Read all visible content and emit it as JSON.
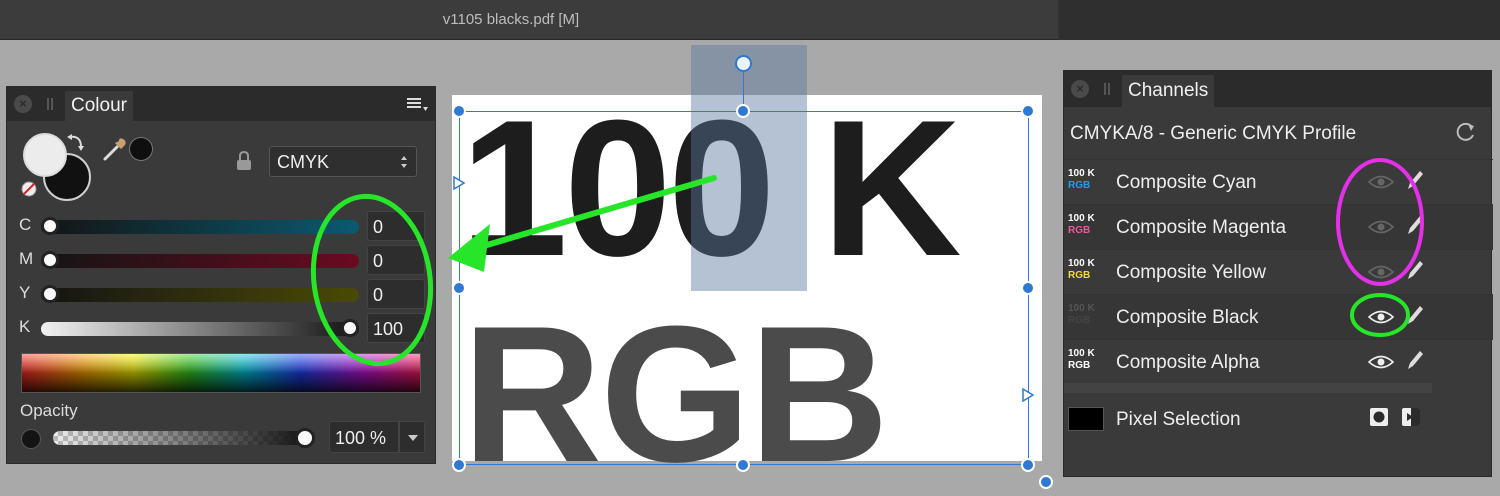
{
  "window": {
    "title": "v1105 blacks.pdf [M]"
  },
  "colour_panel": {
    "tab_label": "Colour",
    "model": "CMYK",
    "sliders": [
      {
        "label": "C",
        "value": "0",
        "fraction": 0.0,
        "color": "#0a5a70"
      },
      {
        "label": "M",
        "value": "0",
        "fraction": 0.0,
        "color": "#6a0a22"
      },
      {
        "label": "Y",
        "value": "0",
        "fraction": 0.0,
        "color": "#4a4a06"
      },
      {
        "label": "K",
        "value": "100",
        "fraction": 1.0,
        "color": "#ffffff"
      }
    ],
    "opacity_label": "Opacity",
    "opacity_value": "100 %",
    "opacity_fraction": 1.0
  },
  "canvas": {
    "line1": "100 K",
    "line2": "RGB"
  },
  "channels_panel": {
    "tab_label": "Channels",
    "profile": "CMYKA/8 - Generic CMYK Profile",
    "channels": [
      {
        "thumb_top": "100 K",
        "thumb_bottom": "RGB",
        "thumb_color": "#1aa3e8",
        "name": "Composite Cyan",
        "visible": false
      },
      {
        "thumb_top": "100 K",
        "thumb_bottom": "RGB",
        "thumb_color": "#e85a9c",
        "name": "Composite Magenta",
        "visible": false
      },
      {
        "thumb_top": "100 K",
        "thumb_bottom": "RGB",
        "thumb_color": "#f2dc3a",
        "name": "Composite Yellow",
        "visible": false
      },
      {
        "thumb_top": "100 K",
        "thumb_bottom": "RGB",
        "thumb_color": "#444444",
        "name": "Composite Black",
        "visible": true
      },
      {
        "thumb_top": "100 K",
        "thumb_bottom": "RGB",
        "thumb_color": "#ffffff",
        "name": "Composite Alpha",
        "visible": true
      }
    ],
    "pixel_selection_label": "Pixel Selection"
  },
  "colors": {
    "selection_blue": "#2f78d4",
    "annotation_green": "#27e62a",
    "annotation_magenta": "#e431e8"
  }
}
